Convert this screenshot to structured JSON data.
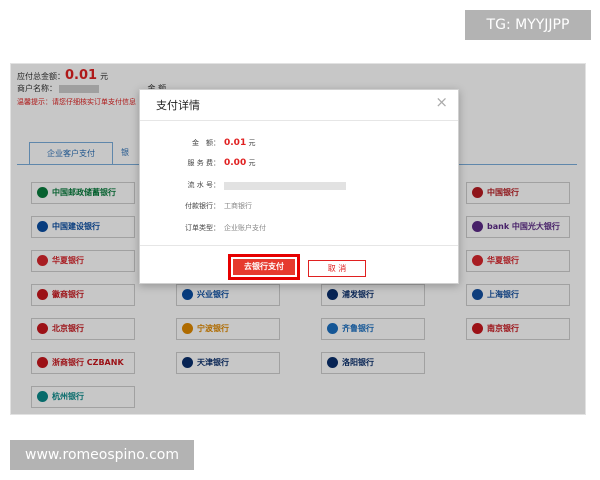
{
  "watermarks": {
    "top": "TG: MYYJJPP",
    "bottom": "www.romeospino.com"
  },
  "summary": {
    "total_label": "应付总金额：",
    "total_amount": "0.01",
    "total_unit": "元",
    "merchant_label": "商户名称：",
    "amount_label": "金 额",
    "notice": "温馨提示：请您仔细核实订单支付信息"
  },
  "tabs": [
    {
      "label": "企业客户支付"
    },
    {
      "label": "银"
    }
  ],
  "banks": [
    {
      "name": "中国邮政储蓄银行",
      "color": "#0a7d3e"
    },
    {
      "name": "中国银行",
      "color": "#b81c22"
    },
    {
      "name": "中国建设银行",
      "color": "#0a4da2"
    },
    {
      "name": "bank 中国光大银行",
      "color": "#5b2a86"
    },
    {
      "name": "华夏银行",
      "color": "#d8262c"
    },
    {
      "name": "华夏银行",
      "color": "#d8262c"
    },
    {
      "name": "徽商银行",
      "color": "#c8161d"
    },
    {
      "name": "兴业银行",
      "color": "#0a4da2"
    },
    {
      "name": "浦发银行",
      "color": "#0a2f6c"
    },
    {
      "name": "上海银行",
      "color": "#1450a0"
    },
    {
      "name": "北京银行",
      "color": "#c8161d"
    },
    {
      "name": "宁波银行",
      "color": "#e08a00"
    },
    {
      "name": "齐鲁银行",
      "color": "#1a6fc0"
    },
    {
      "name": "南京银行",
      "color": "#c8161d"
    },
    {
      "name": "浙商银行 CZBANK",
      "color": "#c8161d"
    },
    {
      "name": "天津银行",
      "color": "#0a2f6c"
    },
    {
      "name": "洛阳银行",
      "color": "#0a2f6c"
    },
    {
      "name": "杭州银行",
      "color": "#0a8a8a"
    }
  ],
  "modal": {
    "title": "支付详情",
    "close_icon": "close-icon",
    "fields": [
      {
        "label": "金　额：",
        "value": "0.01",
        "unit": "元"
      },
      {
        "label": "服 务 费：",
        "value": "0.00",
        "unit": "元"
      },
      {
        "label": "流 水 号：",
        "value": ""
      },
      {
        "label": "付款银行：",
        "value": "工商银行"
      },
      {
        "label": "订单类型：",
        "value": "企业账户支付"
      }
    ],
    "confirm_label": "去银行支付",
    "cancel_label": "取 消"
  }
}
